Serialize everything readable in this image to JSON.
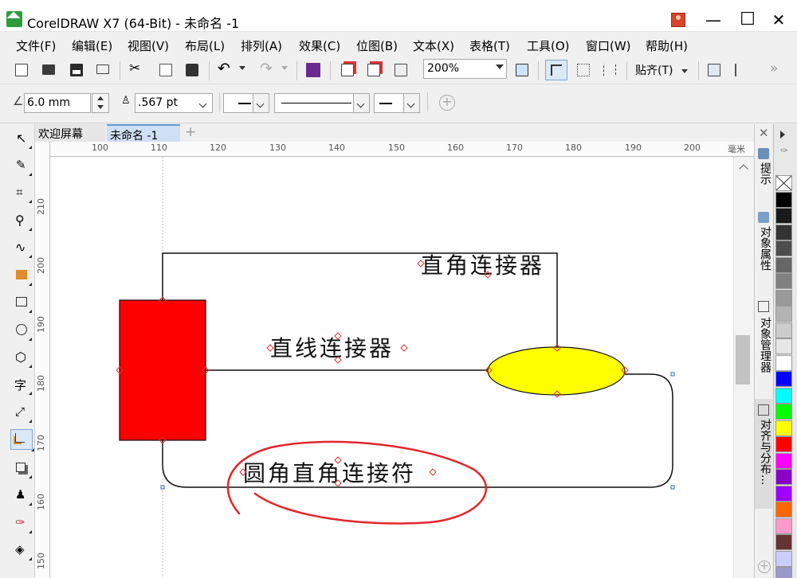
{
  "window": {
    "title": "CorelDRAW X7 (64-Bit) - 未命名 -1",
    "minimize": "—",
    "maximize": "☐",
    "close": "✕"
  },
  "menu": [
    "文件(F)",
    "编辑(E)",
    "视图(V)",
    "布局(L)",
    "排列(A)",
    "效果(C)",
    "位图(B)",
    "文本(X)",
    "表格(T)",
    "工具(O)",
    "窗口(W)",
    "帮助(H)"
  ],
  "standard_toolbar": {
    "zoom_level": "200%",
    "snap_label": "贴齐(T)",
    "more": "»"
  },
  "property_bar": {
    "corner_radius": "6.0 mm",
    "outline_width": ".567 pt"
  },
  "doc_tabs": {
    "welcome": "欢迎屏幕",
    "document": "未命名 -1",
    "add": "+"
  },
  "ruler": {
    "h_ticks": [
      "100",
      "110",
      "120",
      "130",
      "140",
      "150",
      "160",
      "170",
      "180",
      "190",
      "200"
    ],
    "h_unit": "毫米",
    "v_ticks": [
      "210",
      "200",
      "190",
      "180",
      "170",
      "160",
      "150"
    ]
  },
  "canvas": {
    "label_right_angle": "直角连接器",
    "label_straight": "直线连接器",
    "label_rounded": "圆角直角连接符"
  },
  "colors": {
    "rect_fill": "#ff0000",
    "ellipse_fill": "#ffff00",
    "annotation": "#e3262b",
    "selection_handle": "#1c6bd6"
  },
  "dockers": {
    "hint": "提示",
    "object_properties": "对象属性",
    "object_manager": "对象管理器",
    "align_distribute": "对齐与分布..."
  },
  "palette": [
    "none",
    "#000000",
    "#1a1a1a",
    "#333333",
    "#4d4d4d",
    "#666666",
    "#808080",
    "#999999",
    "#b3b3b3",
    "#cccccc",
    "#e6e6e6",
    "#ffffff",
    "#0000ff",
    "#00ffff",
    "#00ff00",
    "#ffff00",
    "#ff0000",
    "#ff00ff",
    "#8b00c7",
    "#a000ff",
    "#ff6600",
    "#ff99cc",
    "#663333",
    "#ccccff",
    "#9999cc"
  ]
}
